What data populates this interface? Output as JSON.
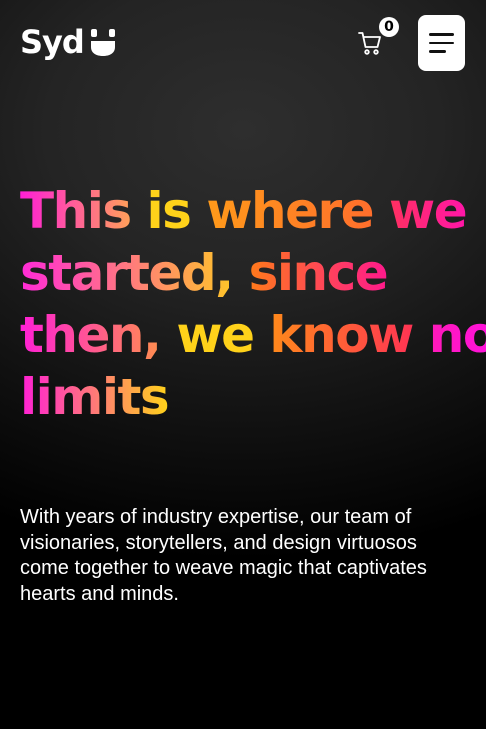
{
  "header": {
    "logo_text": "Syd",
    "cart_count": "0"
  },
  "hero": {
    "lines": [
      {
        "words": [
          {
            "text": "This ",
            "gradient": [
              "#ff1fd6",
              "#ffb347"
            ]
          },
          {
            "text": "is ",
            "gradient": [
              "#ffd21a",
              "#ffd21a"
            ]
          },
          {
            "text": "where ",
            "gradient": [
              "#ff9a1a",
              "#ff6a2e"
            ]
          },
          {
            "text": "we",
            "gradient": [
              "#ff3060",
              "#ff16a8"
            ]
          }
        ]
      },
      {
        "words": [
          {
            "text": "started, ",
            "gradient": [
              "#ff2ad8",
              "#ffd21a"
            ]
          },
          {
            "text": "since",
            "gradient": [
              "#ff7a1a",
              "#ff1a8c"
            ]
          }
        ]
      },
      {
        "words": [
          {
            "text": "then, ",
            "gradient": [
              "#ff1fd6",
              "#ff9a40"
            ]
          },
          {
            "text": "we ",
            "gradient": [
              "#ffd21a",
              "#ffd21a"
            ]
          },
          {
            "text": "know ",
            "gradient": [
              "#ff8a1a",
              "#ff2a5a"
            ]
          },
          {
            "text": "no",
            "gradient": [
              "#ff1ab8",
              "#ff10e0"
            ]
          }
        ]
      },
      {
        "words": [
          {
            "text": "limits",
            "gradient": [
              "#ff1fd6",
              "#ffd21a"
            ]
          }
        ]
      }
    ]
  },
  "description": "With years of industry expertise, our team of visionaries, storytellers, and design virtuosos come together to weave magic that captivates hearts and minds."
}
